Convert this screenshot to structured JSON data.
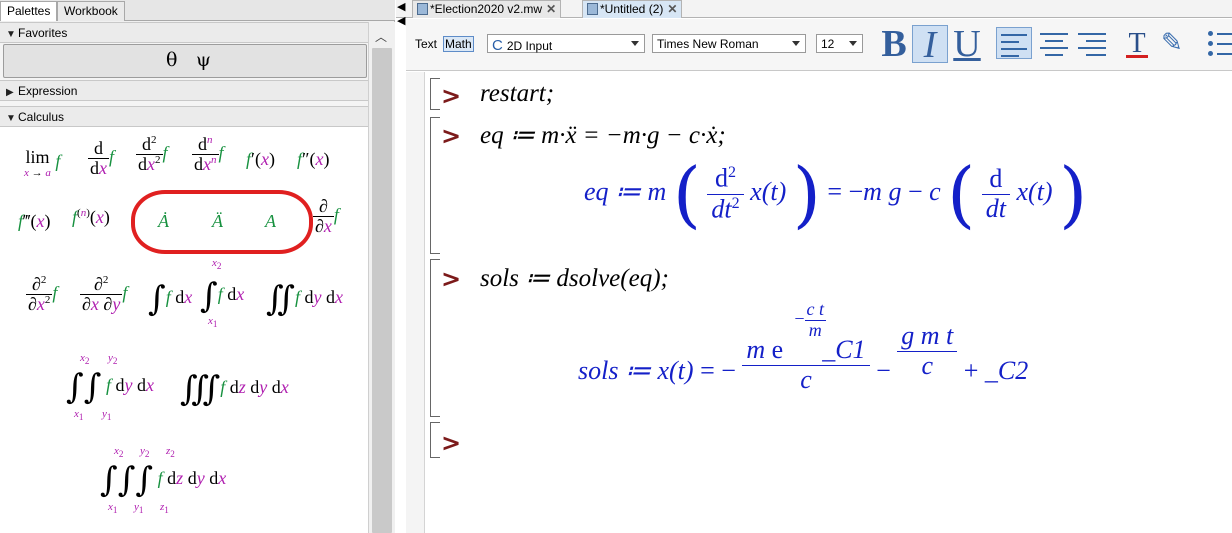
{
  "left_panel": {
    "tabs": [
      "Palettes",
      "Workbook"
    ],
    "sections": {
      "favorites": "Favorites",
      "expression": "Expression",
      "calculus": "Calculus"
    },
    "favorites_items": [
      "θ",
      "ψ"
    ]
  },
  "doc_tabs": [
    {
      "label": "*Election2020 v2.mw",
      "close": "✕"
    },
    {
      "label": "*Untitled (2)",
      "close": "✕"
    }
  ],
  "toolbar": {
    "text_label": "Text",
    "math_label": "Math",
    "input_mode": "2D Input",
    "font": "Times New Roman",
    "size": "12",
    "bold": "B",
    "italic": "I",
    "underline": "U",
    "text_color": "T"
  },
  "worksheet": {
    "prompt_symbol": ">",
    "inputs": [
      "restart;",
      "eq ≔ m·ẍ = −m·g − c·ẋ;",
      "sols ≔ dsolve(eq);"
    ],
    "outputs": {
      "eq_label": "eq ≔",
      "sols_label": "sols ≔"
    }
  },
  "colors": {
    "output_blue": "#1420c8",
    "prompt_red": "#7c1a1a",
    "palette_green": "#189140",
    "palette_magenta": "#b020b0",
    "annotation_red": "#e02020"
  },
  "icons": [
    "scroll-up-icon",
    "collapse-triangle-icon",
    "expand-triangle-icon",
    "document-icon",
    "close-icon",
    "align-left-icon",
    "align-center-icon",
    "align-right-icon",
    "highlighter-icon",
    "bullet-list-icon"
  ]
}
